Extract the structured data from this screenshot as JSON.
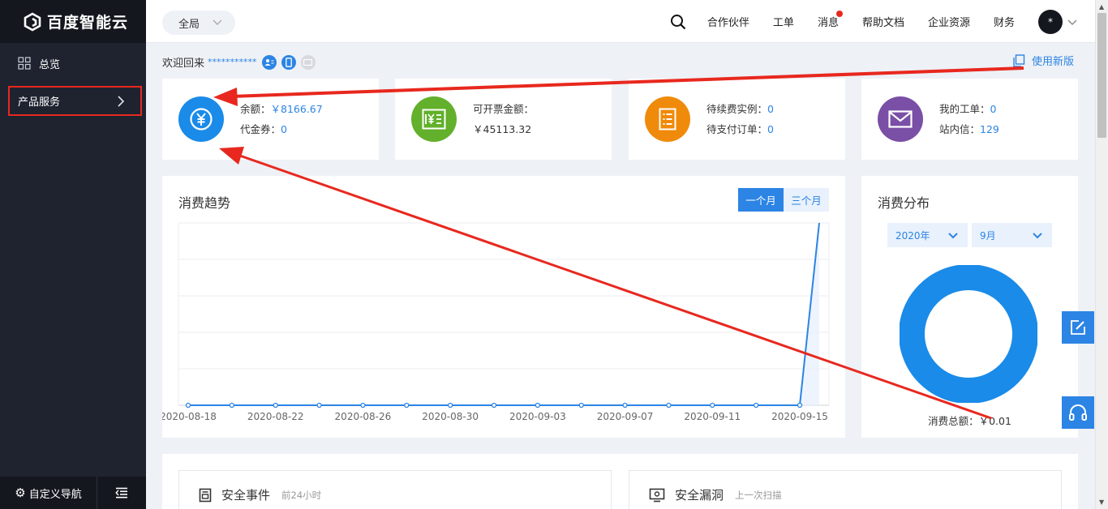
{
  "brand": {
    "name": "百度智能云"
  },
  "sidebar": {
    "items": [
      {
        "label": "总览",
        "icon": "grid-icon"
      },
      {
        "label": "产品服务",
        "icon": "chevron-right-icon"
      }
    ],
    "footer": {
      "custom_nav": "自定义导航",
      "collapse_icon": "collapse-menu-icon"
    }
  },
  "header": {
    "scope": "全局",
    "links": [
      "合作伙伴",
      "工单",
      "消息",
      "帮助文档",
      "企业资源",
      "财务"
    ],
    "avatar": "*"
  },
  "welcome": {
    "greeting": "欢迎回来",
    "account": "***********",
    "use_new": "使用新版"
  },
  "stats": {
    "balance_label": "余额：",
    "balance_value": "￥8166.67",
    "voucher_label": "代金券：",
    "voucher_value": "0",
    "invoice_label": "可开票金额：",
    "invoice_value": "￥45113.32",
    "renew_label": "待续费实例：",
    "renew_value": "0",
    "unpaid_label": "待支付订单：",
    "unpaid_value": "0",
    "ticket_label": "我的工单：",
    "ticket_value": "0",
    "inbox_label": "站内信：",
    "inbox_value": "129"
  },
  "trend": {
    "title": "消费趋势",
    "tabs": [
      "一个月",
      "三个月"
    ]
  },
  "distribution": {
    "title": "消费分布",
    "year": "2020年",
    "month": "9月",
    "total_label": "消费总额：",
    "total_value": "￥0.01"
  },
  "security": {
    "events_title": "安全事件",
    "events_sub": "前24小时",
    "vuln_title": "安全漏洞",
    "vuln_sub": "上一次扫描"
  },
  "colors": {
    "accent": "#2c84e4",
    "sidebar": "#1f2330",
    "balance": "#1a8be8",
    "invoice": "#62b02b",
    "renew": "#f08a0a",
    "ticket": "#7a4fa6",
    "annotation": "#e8281e"
  },
  "chart_data": {
    "type": "line",
    "x": [
      "2020-08-18",
      "2020-08-20",
      "2020-08-22",
      "2020-08-24",
      "2020-08-26",
      "2020-08-28",
      "2020-08-30",
      "2020-09-01",
      "2020-09-03",
      "2020-09-05",
      "2020-09-07",
      "2020-09-09",
      "2020-09-11",
      "2020-09-13",
      "2020-09-15",
      "2020-09-16"
    ],
    "tick_labels": [
      "2020-08-18",
      "2020-08-22",
      "2020-08-26",
      "2020-08-30",
      "2020-09-03",
      "2020-09-07",
      "2020-09-11",
      "2020-09-15"
    ],
    "series": [
      {
        "values": [
          0,
          0,
          0,
          0,
          0,
          0,
          0,
          0,
          0,
          0,
          0,
          0,
          0,
          0,
          0,
          0.01
        ]
      }
    ],
    "ylim": [
      0,
      0.01
    ],
    "grid": true
  }
}
